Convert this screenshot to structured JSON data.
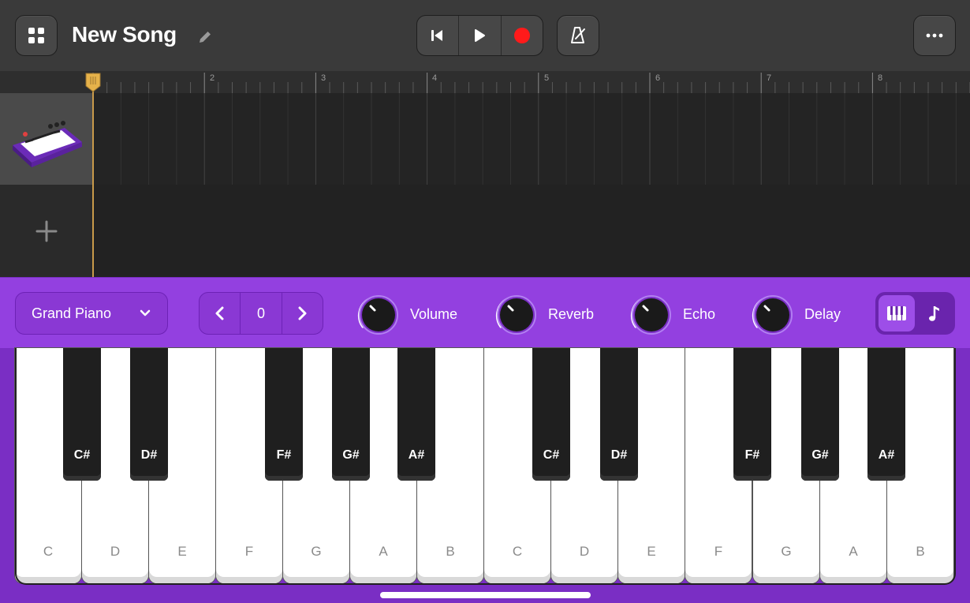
{
  "header": {
    "song_title": "New Song",
    "icons": {
      "apps": "apps-grid-icon",
      "rename": "pencil-icon",
      "rewind": "skip-back-icon",
      "play": "play-icon",
      "record": "record-icon",
      "metronome": "metronome-icon",
      "more": "more-icon"
    },
    "record_color": "#ff1a1a"
  },
  "ruler": {
    "bars": [
      "2",
      "3",
      "4",
      "5",
      "6",
      "7",
      "8"
    ]
  },
  "tracks": {
    "instrument_icon": "keyboard-synth-icon",
    "add_icon": "plus-icon"
  },
  "controls": {
    "instrument": "Grand Piano",
    "octave_value": "0",
    "knobs": [
      "Volume",
      "Reverb",
      "Echo",
      "Delay"
    ],
    "accent_color": "#9340e0"
  },
  "keyboard": {
    "white_keys": [
      "C",
      "D",
      "E",
      "F",
      "G",
      "A",
      "B",
      "C",
      "D",
      "E",
      "F",
      "G",
      "A",
      "B"
    ],
    "black_keys": [
      "C#",
      "D#",
      "F#",
      "G#",
      "A#",
      "C#",
      "D#",
      "F#",
      "G#",
      "A#"
    ]
  }
}
